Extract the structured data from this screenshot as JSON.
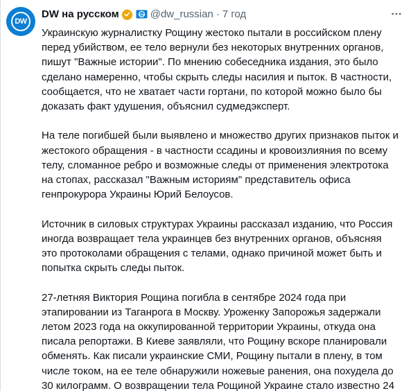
{
  "author": {
    "display_name": "DW на русском",
    "handle": "@dw_russian",
    "separator": "·",
    "time": "7 год",
    "avatar_text": "DW",
    "brand_color": "#0a7fd3",
    "verified_color": "#e8a80c"
  },
  "icons": {
    "verified": "gold-verified-badge-icon",
    "affiliate": "dw-affiliate-icon",
    "more": "more-options-icon"
  },
  "body": {
    "paragraphs": [
      "Украинскую журналистку Рощину жестоко пытали в российском плену перед убийством, ее тело вернули без некоторых внутренних органов, пишут \"Важные истории\". По мнению собеседника издания, это было сделано намеренно, чтобы скрыть следы насилия и пыток. В частности, сообщается, что не хватает части гортани, по которой можно было бы доказать факт удушения, объяснил судмедэксперт.",
      "На теле погибшей были выявлено и множество других признаков пыток и жестокого обращения - в частности ссадины и кровоизлияния по всему телу, сломанное ребро и возможные следы от применения электротока на стопах, рассказал \"Важным историям\" представитель офиса генпрокурора Украины Юрий Белоусов.",
      "Источник в силовых структурах Украины рассказал изданию, что Россия иногда возвращает тела украинцев без внутренних органов, объясняя это протоколами обращения с телами, однако причиной может быть и попытка скрыть следы пыток.",
      "27-летняя Виктория Рощина погибла в сентябре 2024 года при этапировании из Таганрога в Москву. Уроженку Запорожья задержали летом 2023 года на оккупированной территории Украины, откуда она писала репортажи. В Киеве заявляли, что Рощину вскоре планировали обменять. Как писали украинские СМИ, Рощину пытали в плену, в том числе током, на ее теле обнаружили ножевые ранения, она похудела до 30 килограмм. О возвращении тела Рощиной Украине стало известно 24 апреля"
    ]
  }
}
